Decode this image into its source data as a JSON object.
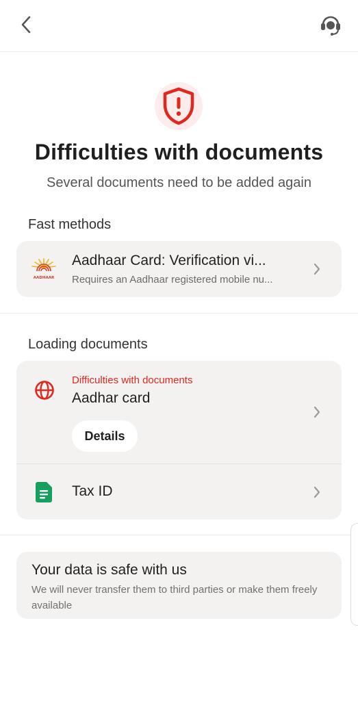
{
  "header": {
    "back_icon": "chevron-left-icon",
    "support_icon": "headset-icon"
  },
  "hero": {
    "icon": "shield-alert-icon",
    "title": "Difficulties with documents",
    "subtitle": "Several documents need to be added again"
  },
  "fast_methods": {
    "label": "Fast methods",
    "item": {
      "icon": "aadhaar-logo",
      "logo_text": "AADHAAR",
      "title": "Aadhaar Card: Verification vi...",
      "subtitle": "Requires an Aadhaar registered mobile nu..."
    }
  },
  "loading_documents": {
    "label": "Loading documents",
    "items": [
      {
        "icon": "globe-icon",
        "error": "Difficulties with documents",
        "title": "Aadhar card",
        "action_label": "Details"
      },
      {
        "icon": "file-document-icon",
        "title": "Tax ID"
      }
    ]
  },
  "safety": {
    "title": "Your data is safe with us",
    "text": "We will never transfer them to third parties or make them freely available"
  },
  "colors": {
    "accent_red": "#e0281f",
    "card_bg": "#f4f2f1",
    "doc_green": "#17a05d"
  }
}
